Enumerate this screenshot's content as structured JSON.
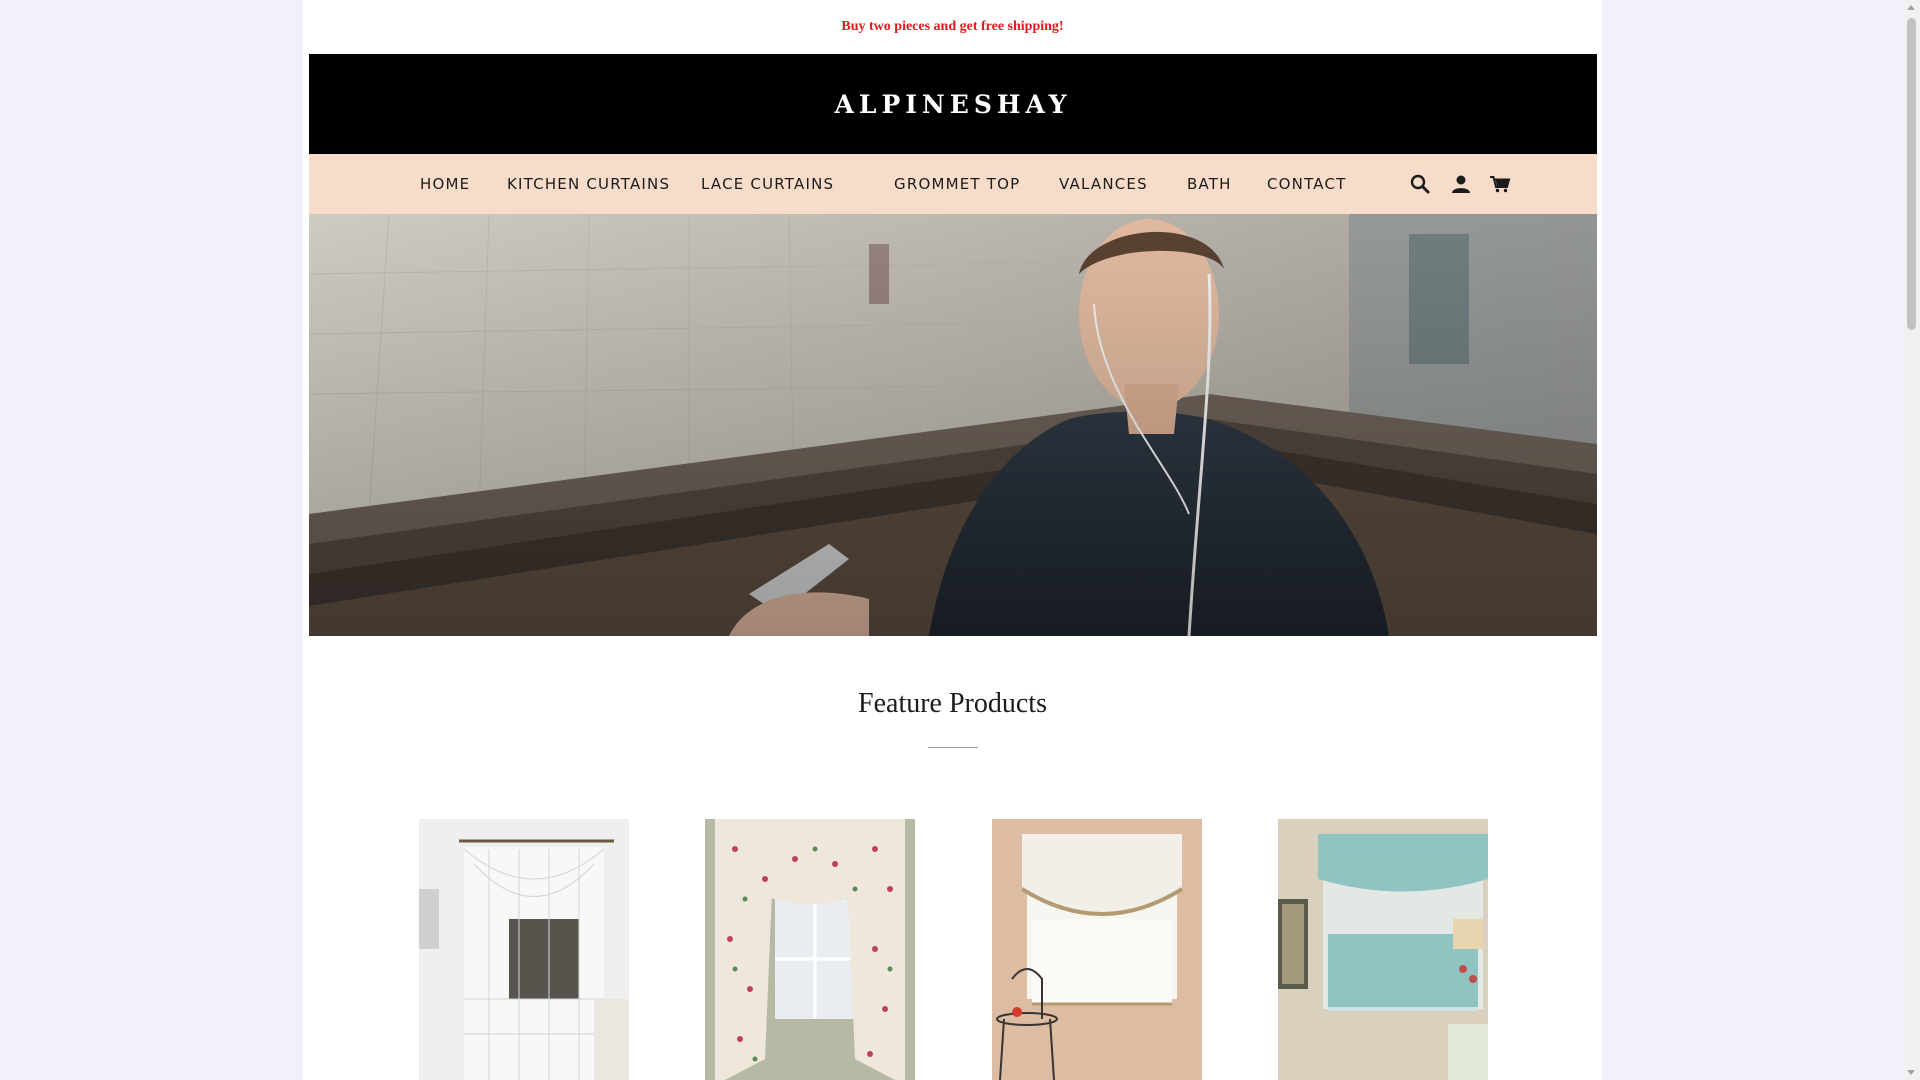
{
  "announcement": {
    "text": "Buy two pieces and get free shipping!",
    "color": "#e01b1b"
  },
  "header": {
    "logo": "ALPINESHAY",
    "background": "#000000"
  },
  "nav": {
    "background": "#f6dcc9",
    "items": [
      {
        "label": "HOME"
      },
      {
        "label": "KITCHEN CURTAINS"
      },
      {
        "label": "LACE CURTAINS"
      },
      {
        "label": "GROMMET TOP"
      },
      {
        "label": "VALANCES"
      },
      {
        "label": "BATH"
      },
      {
        "label": "CONTACT"
      }
    ],
    "icons": [
      "search-icon",
      "account-icon",
      "cart-icon"
    ]
  },
  "hero": {
    "image": "man-with-earphones-looking-at-phone-in-subway-station"
  },
  "featured": {
    "title": "Feature Products",
    "products": [
      {
        "image": "white-lace-kitchen-curtain"
      },
      {
        "image": "floral-print-tier-and-swag-curtain"
      },
      {
        "image": "white-tier-curtain-with-embroidered-swag"
      },
      {
        "image": "aqua-tier-curtain-with-embroidered-valance"
      }
    ]
  }
}
